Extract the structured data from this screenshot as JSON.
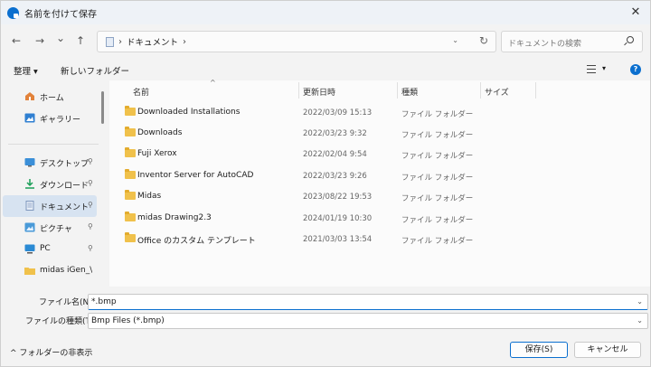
{
  "window": {
    "title": "名前を付けて保存",
    "close_glyph": "✕"
  },
  "nav": {
    "back": "←",
    "forward": "→",
    "recent": "⌄",
    "up": "↑",
    "address": {
      "separator": "›",
      "crumb": "ドキュメント",
      "trailing": "›",
      "dropdown": "⌄",
      "refresh": "↻"
    },
    "search_placeholder": "ドキュメントの検索"
  },
  "toolbar": {
    "organize": "整理 ▾",
    "new_folder": "新しいフォルダー",
    "view_dd": "▾",
    "help": "?"
  },
  "sidebar": {
    "items": [
      {
        "label": "ホーム",
        "icon": "home-icon",
        "pinned": false
      },
      {
        "label": "ギャラリー",
        "icon": "gallery-icon",
        "pinned": false
      },
      {
        "label": "デスクトップ",
        "icon": "desktop-icon",
        "pinned": true
      },
      {
        "label": "ダウンロード",
        "icon": "download-icon",
        "pinned": true
      },
      {
        "label": "ドキュメント",
        "icon": "document-icon",
        "pinned": true,
        "selected": true
      },
      {
        "label": "ピクチャ",
        "icon": "picture-icon",
        "pinned": true
      },
      {
        "label": "PC",
        "icon": "pc-icon",
        "pinned": true
      },
      {
        "label": "midas iGen_\\",
        "icon": "folder-icon",
        "pinned": false
      }
    ],
    "pin_glyph": "📌"
  },
  "files": {
    "columns": [
      "名前",
      "更新日時",
      "種類",
      "サイズ"
    ],
    "sort_glyph": "^",
    "rows": [
      {
        "name": "Downloaded Installations",
        "date": "2022/03/09 15:13",
        "type": "ファイル フォルダー"
      },
      {
        "name": "Downloads",
        "date": "2022/03/23 9:32",
        "type": "ファイル フォルダー"
      },
      {
        "name": "Fuji Xerox",
        "date": "2022/02/04 9:54",
        "type": "ファイル フォルダー"
      },
      {
        "name": "Inventor Server for AutoCAD",
        "date": "2022/03/23 9:26",
        "type": "ファイル フォルダー"
      },
      {
        "name": "Midas",
        "date": "2023/08/22 19:53",
        "type": "ファイル フォルダー"
      },
      {
        "name": "midas Drawing2.3",
        "date": "2024/01/19 10:30",
        "type": "ファイル フォルダー"
      },
      {
        "name": "Office のカスタム テンプレート",
        "date": "2021/03/03 13:54",
        "type": "ファイル フォルダー"
      }
    ]
  },
  "bottom": {
    "filename_label": "ファイル名(N):",
    "filename_value": "*.bmp",
    "filetype_label": "ファイルの種類(T):",
    "filetype_value": "Bmp Files (*.bmp)",
    "dropdown": "⌄",
    "hide_folders": "^ フォルダーの非表示",
    "save": "保存(S)",
    "cancel": "キャンセル"
  },
  "colors": {
    "accent": "#0b6fcf",
    "folder": "#f0c14b",
    "selection": "#d7e3f1"
  }
}
